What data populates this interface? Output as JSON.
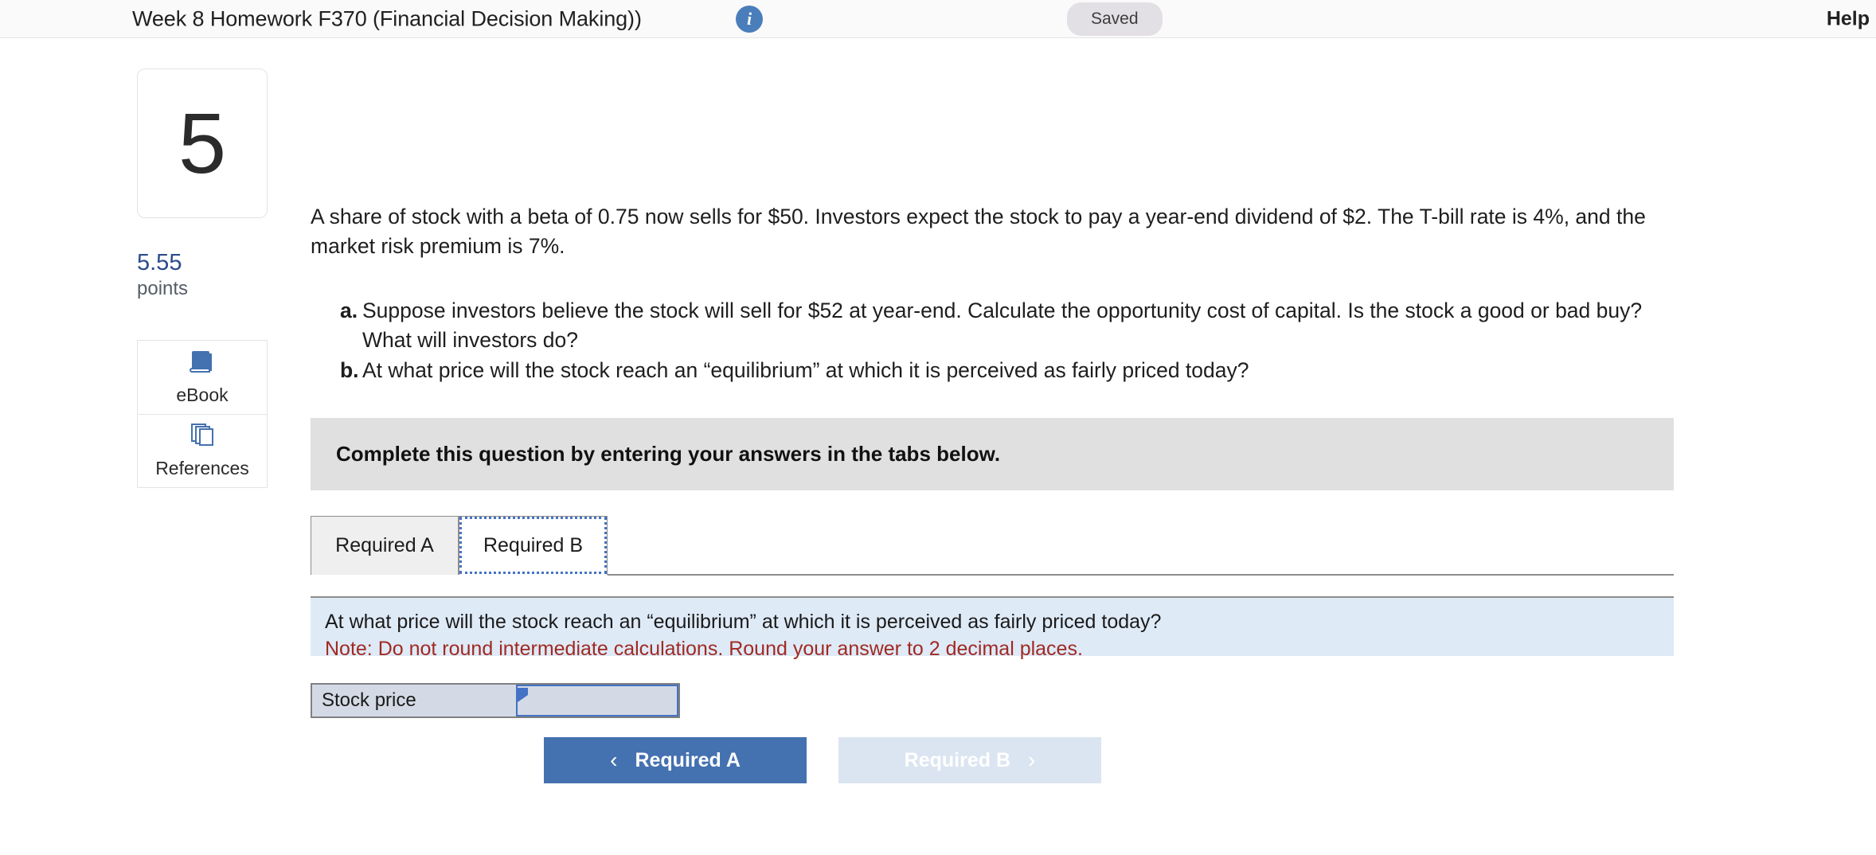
{
  "header": {
    "title": "Week 8 Homework F370 (Financial Decision Making))",
    "info_icon": "info-icon",
    "saved_label": "Saved",
    "help_label": "Help"
  },
  "rail": {
    "question_number": "5",
    "points_value": "5.55",
    "points_label": "points",
    "tools": [
      {
        "icon": "ebook-icon",
        "label": "eBook"
      },
      {
        "icon": "references-icon",
        "label": "References"
      }
    ]
  },
  "question": {
    "stem": "A share of stock with a beta of 0.75 now sells for $50. Investors expect the stock to pay a year-end dividend of $2. The T-bill rate is 4%, and the market risk premium is 7%.",
    "parts": [
      {
        "mark": "a.",
        "text": "Suppose investors believe the stock will sell for $52 at year-end. Calculate the opportunity cost of capital. Is the stock a good or bad buy? What will investors do?"
      },
      {
        "mark": "b.",
        "text": "At what price will the stock reach an “equilibrium” at which it is perceived as fairly priced today?"
      }
    ]
  },
  "instruction_bar": {
    "text": "Complete this question by entering your answers in the tabs below."
  },
  "tabs": [
    {
      "label": "Required A",
      "active": false
    },
    {
      "label": "Required B",
      "active": true
    }
  ],
  "answer_panel": {
    "prompt": "At what price will the stock reach an “equilibrium” at which it is perceived as fairly priced today?",
    "note": "Note: Do not round intermediate calculations. Round your answer to 2 decimal places."
  },
  "answer_table": {
    "row_label": "Stock price",
    "input_value": "",
    "input_placeholder": ""
  },
  "nav": {
    "prev_label": "Required A",
    "prev_chevron": "‹",
    "next_label": "Required B",
    "next_chevron": "›"
  },
  "colors": {
    "accent_blue": "#4471b0",
    "points_blue": "#2b4b8c",
    "note_red": "#a02a22",
    "panel_blue": "#dfeaf7",
    "instr_gray": "#e0e0e0",
    "focus_blue": "#4472c4",
    "disabled_blue": "#dbe5f1"
  }
}
